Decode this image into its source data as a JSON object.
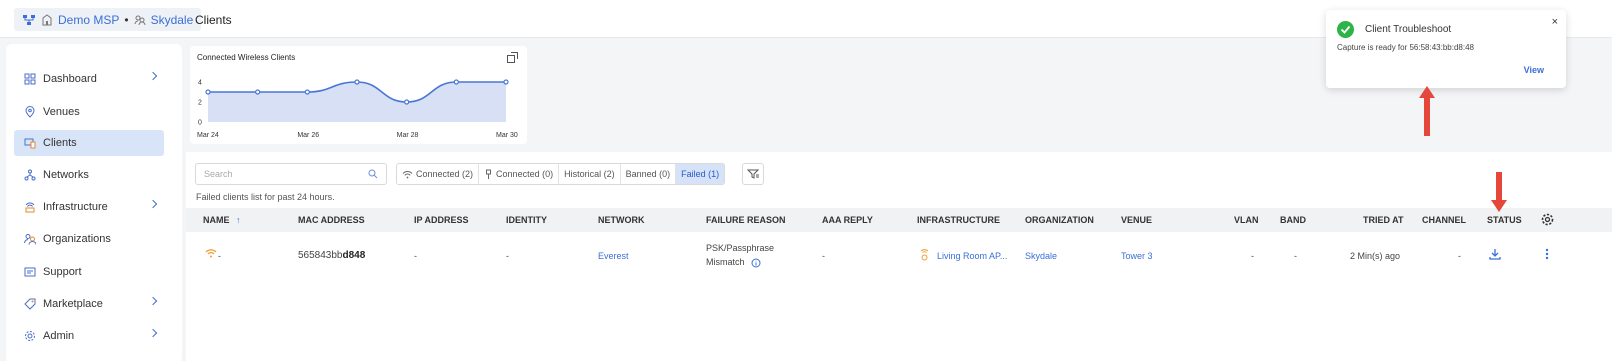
{
  "header": {
    "msp": "Demo MSP",
    "separator": "•",
    "org": "Skydale",
    "title": "Clients"
  },
  "sidebar": {
    "items": [
      {
        "label": "Dashboard",
        "icon": "dashboard-icon",
        "chevron": true
      },
      {
        "label": "Venues",
        "icon": "location-pin-icon",
        "chevron": false
      },
      {
        "label": "Clients",
        "icon": "devices-icon",
        "chevron": false,
        "active": true
      },
      {
        "label": "Networks",
        "icon": "network-tree-icon",
        "chevron": false
      },
      {
        "label": "Infrastructure",
        "icon": "access-point-icon",
        "chevron": true
      },
      {
        "label": "Organizations",
        "icon": "org-users-icon",
        "chevron": false
      },
      {
        "label": "Support",
        "icon": "support-card-icon",
        "chevron": false
      },
      {
        "label": "Marketplace",
        "icon": "tag-icon",
        "chevron": true
      },
      {
        "label": "Admin",
        "icon": "gear-icon",
        "chevron": true
      }
    ]
  },
  "chart_data": {
    "type": "area",
    "title": "Connected Wireless Clients",
    "x": [
      "Mar 24",
      "Mar 25",
      "Mar 26",
      "Mar 27",
      "Mar 28",
      "Mar 29",
      "Mar 30"
    ],
    "x_tick_labels": [
      "Mar 24",
      "Mar 26",
      "Mar 28",
      "Mar 30"
    ],
    "y_ticks": [
      "0",
      "2",
      "4"
    ],
    "values": [
      3,
      3,
      3,
      4,
      2,
      4,
      4
    ],
    "ylim": [
      0,
      4
    ],
    "grid": false,
    "color": "#4a76d4",
    "fill": "#d7e0f4"
  },
  "toolbar": {
    "search_placeholder": "Search",
    "filters": [
      {
        "label": "Connected (2)",
        "icon": "wifi-icon"
      },
      {
        "label": "Connected (0)",
        "icon": "cable-icon"
      },
      {
        "label": "Historical (2)"
      },
      {
        "label": "Banned (0)"
      },
      {
        "label": "Failed (1)",
        "active": true
      }
    ],
    "subtitle": "Failed clients list for past 24 hours."
  },
  "table": {
    "columns": [
      "NAME",
      "MAC ADDRESS",
      "IP ADDRESS",
      "IDENTITY",
      "NETWORK",
      "FAILURE REASON",
      "AAA REPLY",
      "INFRASTRUCTURE",
      "ORGANIZATION",
      "VENUE",
      "VLAN",
      "BAND",
      "TRIED AT",
      "CHANNEL",
      "STATUS"
    ],
    "sort_indicator": "↑",
    "rows": [
      {
        "name": "-",
        "mac_prefix": "565843bb",
        "mac_suffix": "d848",
        "ip": "-",
        "identity": "-",
        "network": "Everest",
        "failure_line1": "PSK/Passphrase",
        "failure_line2": "Mismatch",
        "aaa": "-",
        "infrastructure": "Living Room AP...",
        "organization": "Skydale",
        "venue": "Tower 3",
        "vlan": "-",
        "band": "-",
        "tried_at": "2 Min(s) ago",
        "channel": "-"
      }
    ]
  },
  "toast": {
    "title": "Client Troubleshoot",
    "message": "Capture is ready for 56:58:43:bb:d8:48",
    "action": "View",
    "close": "×"
  },
  "colors": {
    "accent": "#3a6fd8",
    "success": "#2db34a",
    "annotation_arrow": "#e5473b",
    "wifi_warning": "#f29a2e"
  }
}
